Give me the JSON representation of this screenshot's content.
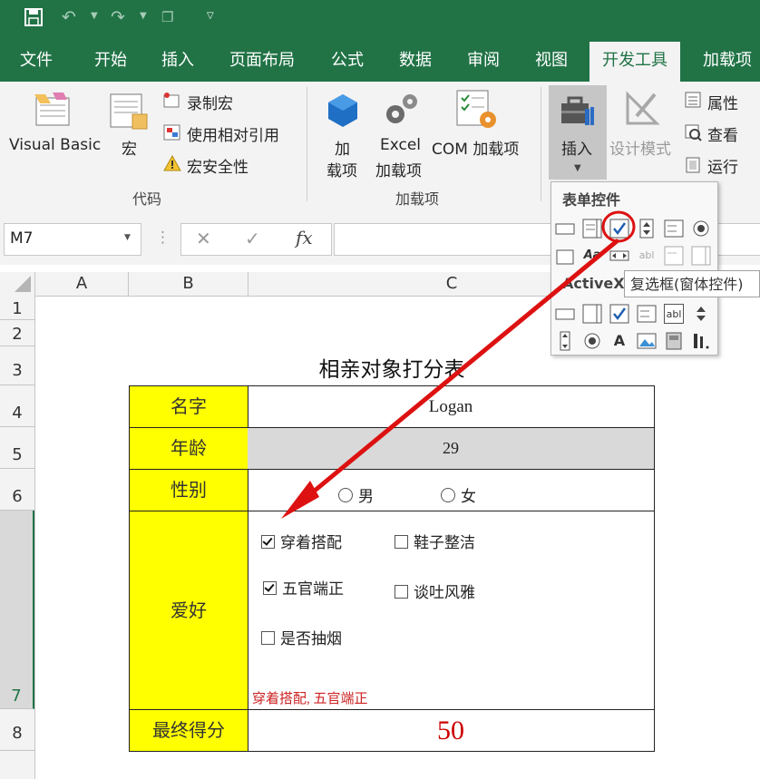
{
  "tabs": [
    "文件",
    "开始",
    "插入",
    "页面布局",
    "公式",
    "数据",
    "审阅",
    "视图",
    "开发工具",
    "加载项"
  ],
  "active_tab": "开发工具",
  "ribbon": {
    "code_group": {
      "visual_basic": "Visual Basic",
      "macro": "宏",
      "record_macro": "录制宏",
      "use_relative": "使用相对引用",
      "macro_security": "宏安全性",
      "label": "代码"
    },
    "addins_group": {
      "addin_line1": "加",
      "addin_line2": "载项",
      "excel_line1": "Excel",
      "excel_line2": "加载项",
      "com": "COM 加载项",
      "label": "加载项"
    },
    "controls_group": {
      "insert": "插入",
      "design_mode": "设计模式",
      "properties": "属性",
      "view_code": "查看",
      "run": "运行"
    }
  },
  "namebox": "M7",
  "formula_icons": {
    "cancel": "✕",
    "enter": "✓",
    "fx": "fx"
  },
  "columns": [
    "A",
    "B",
    "C"
  ],
  "rows": [
    "1",
    "2",
    "3",
    "4",
    "5",
    "6",
    "7",
    "8"
  ],
  "sheet": {
    "title": "相亲对象打分表",
    "name_label": "名字",
    "name_value": "Logan",
    "age_label": "年龄",
    "age_value": "29",
    "gender_label": "性别",
    "gender_male": "男",
    "gender_female": "女",
    "hobby_label": "爱好",
    "hobbies": [
      {
        "label": "穿着搭配",
        "checked": true
      },
      {
        "label": "鞋子整洁",
        "checked": false
      },
      {
        "label": "五官端正",
        "checked": true
      },
      {
        "label": "谈吐风雅",
        "checked": false
      },
      {
        "label": "是否抽烟",
        "checked": false
      }
    ],
    "hobby_result": "穿着搭配, 五官端正",
    "score_label": "最终得分",
    "score_value": "50"
  },
  "panel": {
    "form_controls_header": "表单控件",
    "activex_header": "ActiveX",
    "tooltip": "复选框(窗体控件)"
  },
  "colors": {
    "excel_green": "#217346",
    "yellow": "#ffff00",
    "score_red": "#cc0000",
    "arrow_red": "#dd1111"
  }
}
